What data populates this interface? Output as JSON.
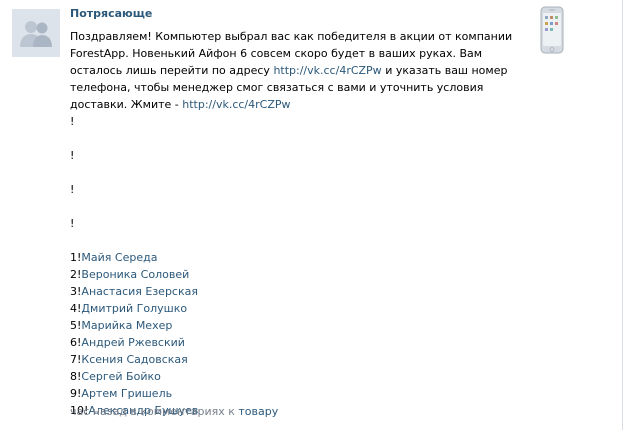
{
  "post": {
    "author": "Потрясающе",
    "text_lead": "Поздравляем! Компьютер выбрал вас как победителя в акции от компании ForestApp. Новенький Айфон 6 совсем скоро будет в ваших руках. Вам осталось лишь перейти по адресу",
    "link1": "http://vk.cc/4rCZPw",
    "text_mid": "и указать ваш номер телефона, чтобы менеджер смог связаться с вами и уточнить условия доставки. Жмите -",
    "link2": "http://vk.cc/4rCZPw",
    "bangs": [
      "!",
      "!",
      "!",
      "!"
    ]
  },
  "winners": [
    {
      "num": "1!",
      "name": "Майя Середа"
    },
    {
      "num": "2!",
      "name": "Вероника Соловей"
    },
    {
      "num": "3!",
      "name": "Анастасия Езерская"
    },
    {
      "num": "4!",
      "name": "Дмитрий Голушко"
    },
    {
      "num": "5!",
      "name": "Марийка Мехер"
    },
    {
      "num": "6!",
      "name": "Андрей Ржевский"
    },
    {
      "num": "7!",
      "name": "Ксения Садовская"
    },
    {
      "num": "8!",
      "name": "Сергей Бойко"
    },
    {
      "num": "9!",
      "name": "Артем Гришель"
    },
    {
      "num": "10!",
      "name": "Александр Бушуев"
    }
  ],
  "meta": {
    "time": "час назад в комментариях к",
    "target": "товару"
  },
  "icons": {
    "avatar": "default-user-avatar-icon",
    "attachment": "iphone-thumbnail-icon"
  },
  "colors": {
    "link": "#2b587a",
    "meta": "#777f8c",
    "avatar_bg": "#dde3ea"
  }
}
